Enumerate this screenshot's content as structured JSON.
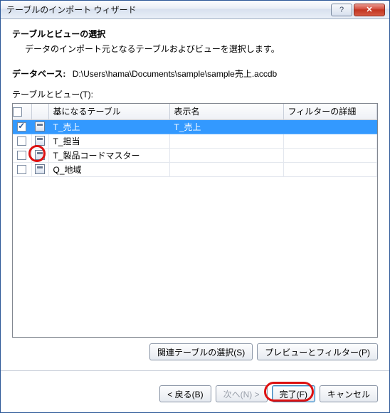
{
  "title": "テーブルのインポート ウィザード",
  "heading": "テーブルとビューの選択",
  "subheading": "データのインポート元となるテーブルおよびビューを選択します。",
  "database_label": "データベース:",
  "database_path": "D:\\Users\\hama\\Documents\\sample\\sample売上.accdb",
  "tv_label": "テーブルとビュー(T):",
  "columns": {
    "source": "基になるテーブル",
    "display": "表示名",
    "filter": "フィルターの詳細"
  },
  "rows": [
    {
      "checked": true,
      "source": "T_売上",
      "display": "T_売上",
      "filter": ""
    },
    {
      "checked": false,
      "source": "T_担当",
      "display": "",
      "filter": ""
    },
    {
      "checked": false,
      "source": "T_製品コードマスター",
      "display": "",
      "filter": ""
    },
    {
      "checked": false,
      "source": "Q_地域",
      "display": "",
      "filter": ""
    }
  ],
  "buttons": {
    "related": "関連テーブルの選択(S)",
    "preview": "プレビューとフィルター(P)",
    "back": "< 戻る(B)",
    "next": "次へ(N) >",
    "finish": "完了(F)",
    "cancel": "キャンセル"
  }
}
